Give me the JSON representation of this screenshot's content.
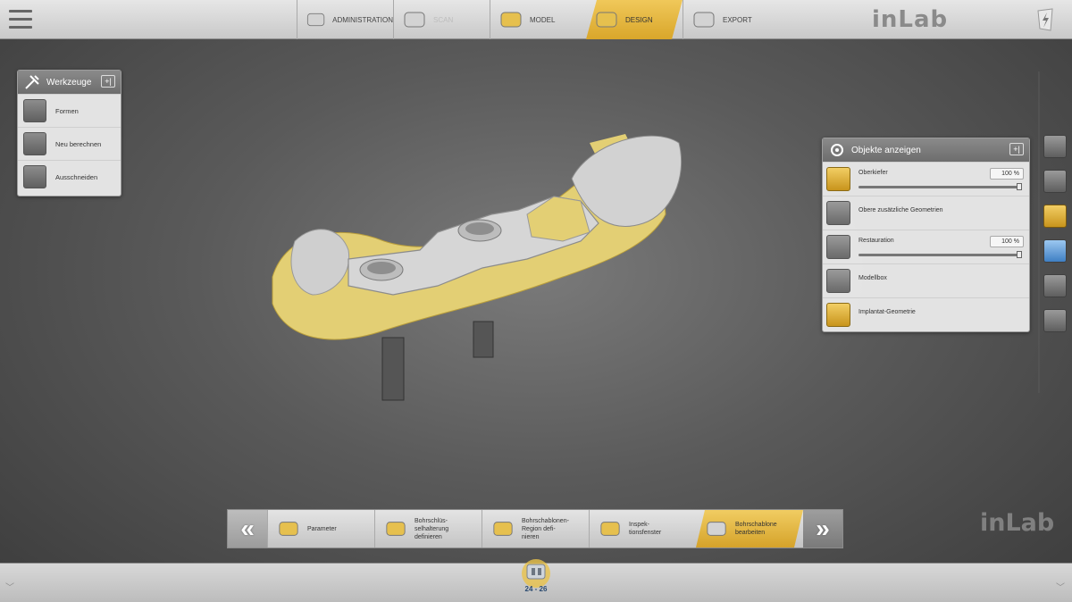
{
  "topbar": {
    "workflow": [
      {
        "label": "ADMINISTRATION",
        "icon": "denture-icon",
        "state": "normal"
      },
      {
        "label": "SCAN",
        "icon": "scan-icon",
        "state": "disabled"
      },
      {
        "label": "MODEL",
        "icon": "model-icon",
        "state": "normal"
      },
      {
        "label": "DESIGN",
        "icon": "design-icon",
        "state": "active"
      },
      {
        "label": "EXPORT",
        "icon": "export-icon",
        "state": "normal"
      }
    ],
    "brand": "inLab"
  },
  "tools_panel": {
    "title": "Werkzeuge",
    "pin": "+|",
    "items": [
      {
        "label": "Formen",
        "icon": "shape-icon"
      },
      {
        "label": "Neu berechnen",
        "icon": "recalculate-icon"
      },
      {
        "label": "Ausschneiden",
        "icon": "cut-icon"
      }
    ]
  },
  "objects_panel": {
    "title": "Objekte anzeigen",
    "pin": "+|",
    "items": [
      {
        "label": "Oberkiefer",
        "icon": "upper-jaw-icon",
        "value": "100 %",
        "slider": 1.0,
        "gold": true
      },
      {
        "label": "Obere zusätzliche Geometrien",
        "icon": "additional-geometry-icon",
        "gold": false
      },
      {
        "label": "Restauration",
        "icon": "restoration-icon",
        "value": "100 %",
        "slider": 1.0,
        "gold": false
      },
      {
        "label": "Modellbox",
        "icon": "model-box-icon",
        "gold": false
      },
      {
        "label": "Implantat-Geometrie",
        "icon": "implant-icon",
        "gold": true
      }
    ]
  },
  "side_toolbar": [
    {
      "icon": "cube-view-icon",
      "style": "gray"
    },
    {
      "icon": "tools-icon",
      "style": "gray"
    },
    {
      "icon": "objects-icon",
      "style": "gold"
    },
    {
      "icon": "screenshot-icon",
      "style": "blue"
    },
    {
      "icon": "head-view-icon",
      "style": "gray"
    },
    {
      "icon": "catalog-icon",
      "style": "gray"
    }
  ],
  "stepbar": {
    "prev": "«",
    "next": "»",
    "steps": [
      {
        "label": "Parameter",
        "icon": "parameter-icon",
        "active": false
      },
      {
        "label": "Bohrschlüs-\nselhalterung\ndefinieren",
        "icon": "drill-key-icon",
        "active": false
      },
      {
        "label": "Bohrschablonen-\nRegion defi-\nnieren",
        "icon": "region-icon",
        "active": false
      },
      {
        "label": "Inspek-\ntionsfenster",
        "icon": "inspection-icon",
        "active": false
      },
      {
        "label": "Bohrschablone\nbearbeiten",
        "icon": "edit-template-icon",
        "active": true
      }
    ]
  },
  "bottombar": {
    "tooth_label": "24 - 26"
  },
  "watermark": "inLab",
  "colors": {
    "accent": "#e0b03a",
    "model_gold": "#e6d27a",
    "template_gray": "#d0d0d0"
  }
}
